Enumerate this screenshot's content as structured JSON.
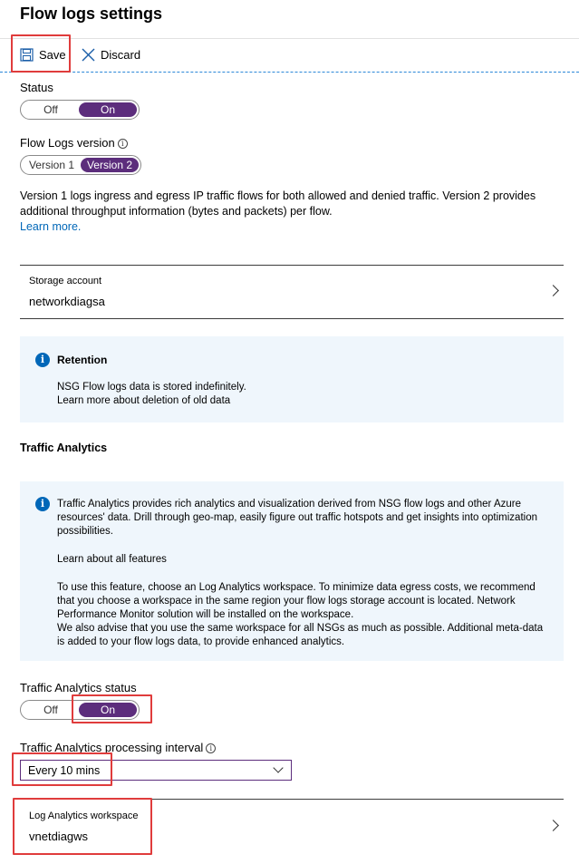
{
  "header": {
    "title": "Flow logs settings"
  },
  "toolbar": {
    "save_label": "Save",
    "discard_label": "Discard"
  },
  "status": {
    "label": "Status",
    "off": "Off",
    "on": "On",
    "selected": "On"
  },
  "version": {
    "label": "Flow Logs version",
    "info_icon": "info-icon",
    "options": [
      "Version 1",
      "Version 2"
    ],
    "selected": "Version 2",
    "description": "Version 1 logs ingress and egress IP traffic flows for both allowed and denied traffic. Version 2 provides additional throughput information (bytes and packets) per flow.",
    "learn_more": "Learn more."
  },
  "storage": {
    "label": "Storage account",
    "value": "networkdiagsa"
  },
  "retention": {
    "title": "Retention",
    "text": "NSG Flow logs data is stored indefinitely.",
    "link": "Learn more about deletion of old data"
  },
  "traffic_analytics": {
    "section_title": "Traffic Analytics",
    "info_p1": "Traffic Analytics provides rich analytics and visualization derived from NSG flow logs and other Azure resources' data. Drill through geo-map, easily figure out traffic hotspots and get insights into optimization possibilities.",
    "features_link": "Learn about all features",
    "info_p2": "To use this feature, choose an Log Analytics workspace. To minimize data egress costs, we recommend that you choose a workspace in the same region your flow logs storage account is located. Network Performance Monitor solution will be installed on the workspace.",
    "info_p3": "We also advise that you use the same workspace for all NSGs as much as possible. Additional meta-data is added to your flow logs data, to provide enhanced analytics.",
    "status_label": "Traffic Analytics status",
    "status_off": "Off",
    "status_on": "On",
    "status_selected": "On",
    "interval_label": "Traffic Analytics processing interval",
    "interval_value": "Every 10 mins",
    "workspace_label": "Log Analytics workspace",
    "workspace_value": "vnetdiagws"
  },
  "colors": {
    "accent": "#5c2d7c",
    "link": "#0067b8",
    "highlight": "#e03c3c",
    "infobox_bg": "#eff6fc"
  }
}
